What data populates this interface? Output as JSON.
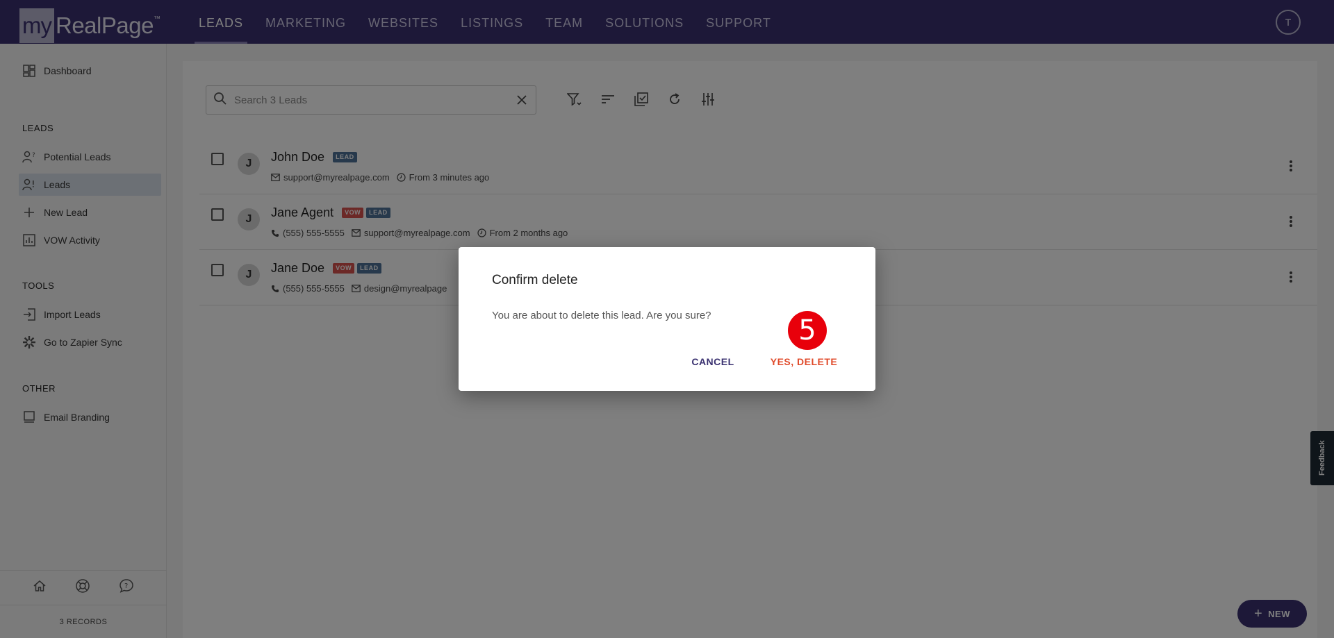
{
  "topbar": {
    "logo_prefix": "my",
    "logo_text": "RealPage",
    "logo_tm": "™",
    "nav": [
      "LEADS",
      "MARKETING",
      "WEBSITES",
      "LISTINGS",
      "TEAM",
      "SOLUTIONS",
      "SUPPORT"
    ],
    "active_nav": "LEADS",
    "user_initial": "T"
  },
  "sidebar": {
    "dashboard": "Dashboard",
    "leads_heading": "LEADS",
    "leads_items": [
      "Potential Leads",
      "Leads",
      "New Lead",
      "VOW Activity"
    ],
    "tools_heading": "TOOLS",
    "tools_items": [
      "Import Leads",
      "Go to Zapier Sync"
    ],
    "other_heading": "OTHER",
    "other_items": [
      "Email Branding"
    ],
    "records": "3 RECORDS"
  },
  "search": {
    "placeholder": "Search 3 Leads"
  },
  "leads": [
    {
      "initial": "J",
      "name": "John Doe",
      "badges": [
        "LEAD"
      ],
      "phone": "",
      "email": "support@myrealpage.com",
      "from": "From 3 minutes ago"
    },
    {
      "initial": "J",
      "name": "Jane Agent",
      "badges": [
        "VOW",
        "LEAD"
      ],
      "phone": "(555) 555-5555",
      "email": "support@myrealpage.com",
      "from": "From 2 months ago"
    },
    {
      "initial": "J",
      "name": "Jane Doe",
      "badges": [
        "VOW",
        "LEAD"
      ],
      "phone": "(555) 555-5555",
      "email": "design@myrealpage",
      "from": ""
    }
  ],
  "feedback": "Feedback",
  "fab_label": "NEW",
  "dialog": {
    "title": "Confirm delete",
    "body": "You are about to delete this lead. Are you sure?",
    "cancel": "CANCEL",
    "confirm": "YES, DELETE"
  },
  "step_marker": "5",
  "colors": {
    "nav_bg": "#3a3170",
    "lead_badge": "#4f7399",
    "vow_badge": "#d9534f",
    "delete": "#e04b2b",
    "step": "#e8000b"
  }
}
